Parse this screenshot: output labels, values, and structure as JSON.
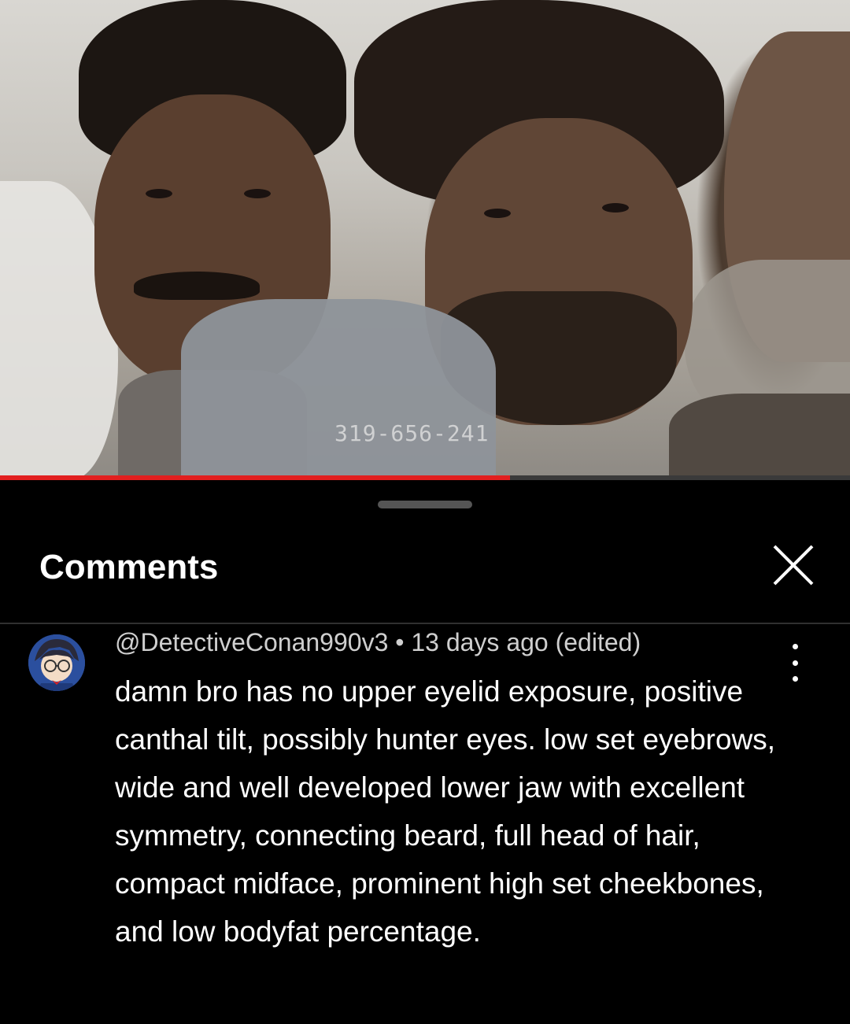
{
  "video": {
    "timecode": "319-656-241",
    "progress_fraction": 0.6
  },
  "comments_panel": {
    "title": "Comments",
    "close_icon": "close-icon",
    "comment": {
      "author": "@DetectiveConan990v3",
      "separator": "•",
      "timestamp": "13 days ago (edited)",
      "text": "damn bro has no upper eyelid exposure, positive canthal tilt, possibly hunter eyes. low set eyebrows, wide and well developed lower jaw with excellent symmetry, connecting beard, full head of hair, compact midface, prominent high set cheekbones, and low bodyfat percentage.",
      "more_icon": "more-vert-icon"
    }
  },
  "colors": {
    "progress": "#e21f1f",
    "background": "#000000",
    "meta_text": "#cfcfcf"
  }
}
